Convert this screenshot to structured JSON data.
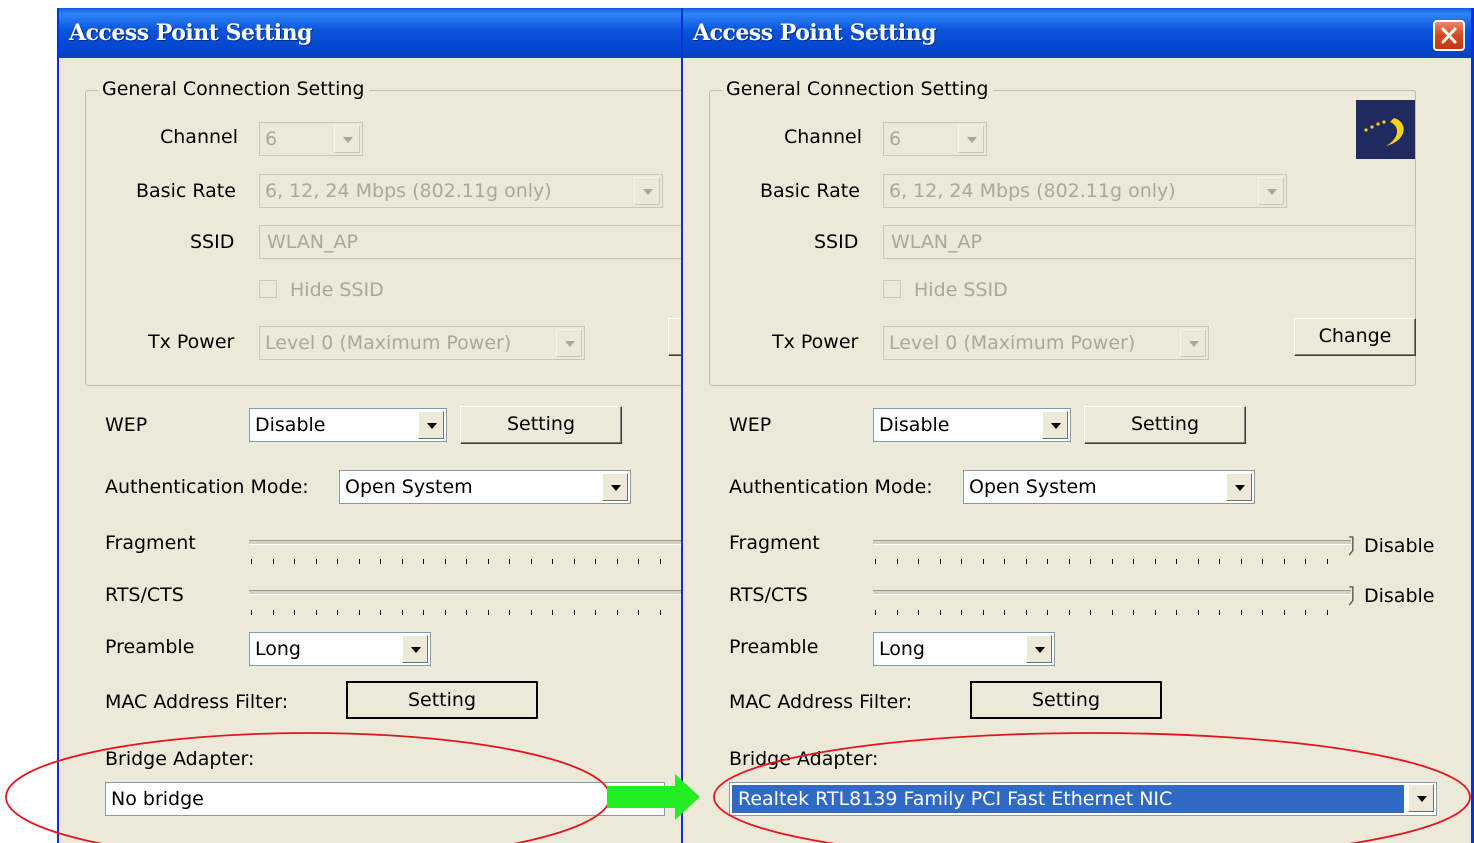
{
  "window_title": "Access Point Setting",
  "general": {
    "legend": "General Connection Setting",
    "channel_label": "Channel",
    "channel_value": "6",
    "basic_rate_label": "Basic Rate",
    "basic_rate_value": "6, 12, 24 Mbps (802.11g only)",
    "ssid_label": "SSID",
    "ssid_value": "WLAN_AP",
    "hide_ssid_label": "Hide SSID",
    "tx_power_label": "Tx Power",
    "tx_power_value": "Level 0 (Maximum Power)",
    "change_label": "Change"
  },
  "wep": {
    "label": "WEP",
    "value": "Disable",
    "setting_label": "Setting"
  },
  "auth": {
    "label": "Authentication Mode:",
    "value": "Open System"
  },
  "fragment": {
    "label": "Fragment",
    "value_label": "Disable"
  },
  "rts": {
    "label": "RTS/CTS",
    "value_label": "Disable"
  },
  "preamble": {
    "label": "Preamble",
    "value": "Long"
  },
  "mac_filter": {
    "label": "MAC Address Filter:",
    "setting_label": "Setting"
  },
  "bridge": {
    "label": "Bridge Adapter:",
    "left_value": "No bridge",
    "right_value": "Realtek RTL8139 Family PCI Fast Ethernet NIC"
  },
  "colors": {
    "title_blue": "#0a53da",
    "dialog_bg": "#ece9d8",
    "selection": "#316ac5",
    "annotation_red": "#e0161e",
    "arrow_green": "#22ee22"
  },
  "icons": {
    "close": "close-icon",
    "logo": "wireless-logo-icon",
    "arrow": "transition-arrow-icon"
  }
}
